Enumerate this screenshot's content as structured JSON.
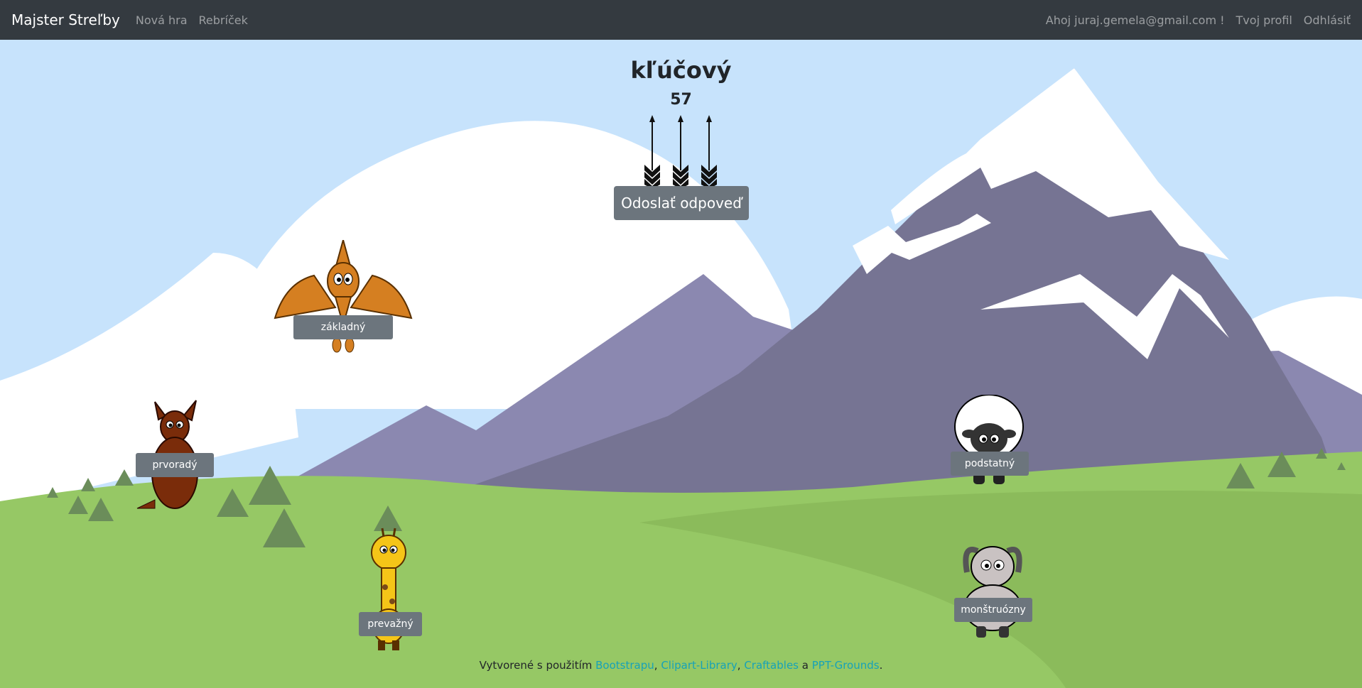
{
  "nav": {
    "brand": "Majster Streľby",
    "links": [
      "Nová hra",
      "Rebríček"
    ],
    "greeting": "Ahoj juraj.gemela@gmail.com !",
    "profile": "Tvoj profil",
    "logout": "Odhlásiť"
  },
  "game": {
    "word": "kľúčový",
    "score": "57",
    "arrows_remaining": 3,
    "submit_label": "Odoslať odpoveď"
  },
  "targets": [
    {
      "animal": "pterodactyl",
      "label": "základný"
    },
    {
      "animal": "kangaroo",
      "label": "prvoradý"
    },
    {
      "animal": "giraffe",
      "label": "prevažný"
    },
    {
      "animal": "sheep",
      "label": "podstatný"
    },
    {
      "animal": "goat",
      "label": "monštruózny"
    }
  ],
  "footer": {
    "prefix": "Vytvorené s použitím",
    "link1": "Bootstrapu",
    "sep1": ",",
    "link2": "Clipart-Library",
    "sep2": ",",
    "link3": "Craftables",
    "and": "a",
    "link4": "PPT-Grounds",
    "end": "."
  },
  "colors": {
    "navbar": "#343a40",
    "sky": "#c7e3fc",
    "grass": "#96c865",
    "mountain": "#767493",
    "button": "#6c757d",
    "link": "#17a2b8"
  }
}
